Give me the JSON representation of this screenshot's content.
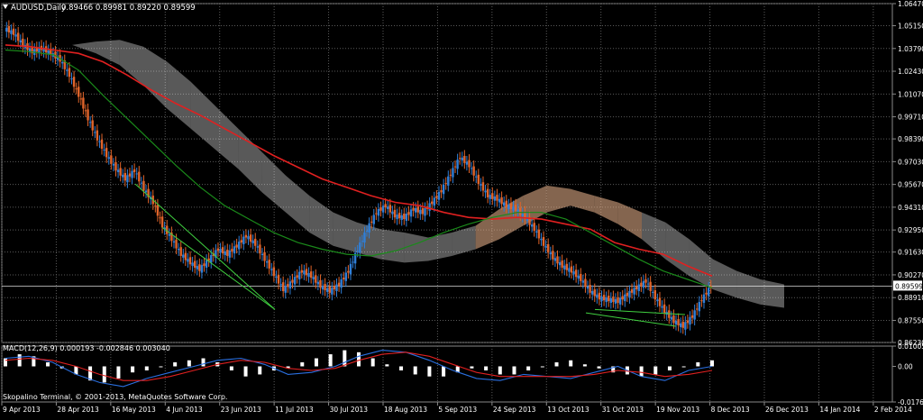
{
  "window": {
    "title": "AUDUSD,Daily",
    "ohlc": "0.89466 0.89981 0.89220 0.89599",
    "copyright": "Skopalino Terminal, © 2001-2013, MetaQuotes Software Corp."
  },
  "colors": {
    "background": "#000000",
    "grid": "#5a5a5a",
    "axis_text": "#ffffff",
    "bull_candle": "#2f7fd8",
    "bear_candle": "#e0642a",
    "ma_slow": "#e02020",
    "ma_fast": "#1a8a1a",
    "cloud_bull": "#f0b890",
    "cloud_bear": "#ffffff",
    "trendline": "#40d040",
    "macd_hist": "#ffffff",
    "macd_line": "#2a6fe0",
    "signal_line": "#e02020",
    "price_label_bg": "#ffffff",
    "price_label_text": "#000000"
  },
  "chart_data": [
    {
      "type": "candlestick",
      "name": "main",
      "yticks": [
        "1.06470",
        "1.05150",
        "1.03790",
        "1.02430",
        "1.01070",
        "0.99710",
        "0.98390",
        "0.97030",
        "0.95670",
        "0.94310",
        "0.92950",
        "0.91630",
        "0.90270",
        "0.88910",
        "0.87550",
        "0.86230"
      ],
      "ylim": [
        0.8623,
        1.0647
      ],
      "current_price": "0.89599",
      "xticks": [
        "9 Apr 2013",
        "28 Apr 2013",
        "16 May 2013",
        "4 Jun 2013",
        "23 Jun 2013",
        "11 Jul 2013",
        "30 Jul 2013",
        "18 Aug 2013",
        "5 Sep 2013",
        "24 Sep 2013",
        "13 Oct 2013",
        "31 Oct 2013",
        "19 Nov 2013",
        "8 Dec 2013",
        "26 Dec 2013",
        "14 Jan 2014",
        "2 Feb 2014"
      ],
      "close_path": [
        1.05,
        1.047,
        1.04,
        1.036,
        1.038,
        1.035,
        1.031,
        1.022,
        1.01,
        0.996,
        0.984,
        0.974,
        0.966,
        0.96,
        0.965,
        0.954,
        0.946,
        0.932,
        0.924,
        0.915,
        0.91,
        0.906,
        0.912,
        0.918,
        0.915,
        0.92,
        0.926,
        0.921,
        0.912,
        0.903,
        0.894,
        0.899,
        0.905,
        0.902,
        0.896,
        0.893,
        0.897,
        0.905,
        0.918,
        0.93,
        0.94,
        0.944,
        0.938,
        0.937,
        0.942,
        0.94,
        0.946,
        0.953,
        0.963,
        0.973,
        0.968,
        0.958,
        0.95,
        0.948,
        0.944,
        0.942,
        0.937,
        0.93,
        0.921,
        0.913,
        0.908,
        0.905,
        0.9,
        0.893,
        0.889,
        0.888,
        0.887,
        0.891,
        0.895,
        0.899,
        0.889,
        0.881,
        0.875,
        0.872,
        0.878,
        0.888,
        0.896
      ],
      "ma_slow": [
        1.04,
        1.039,
        1.037,
        1.035,
        1.03,
        1.022,
        1.013,
        1.005,
        0.998,
        0.99,
        0.982,
        0.974,
        0.967,
        0.96,
        0.955,
        0.95,
        0.946,
        0.944,
        0.94,
        0.937,
        0.936,
        0.937,
        0.936,
        0.933,
        0.93,
        0.922,
        0.918,
        0.915,
        0.908,
        0.902
      ],
      "ma_fast": [
        1.037,
        1.036,
        1.034,
        1.025,
        1.01,
        0.996,
        0.982,
        0.968,
        0.955,
        0.944,
        0.936,
        0.928,
        0.922,
        0.918,
        0.915,
        0.914,
        0.917,
        0.922,
        0.928,
        0.933,
        0.937,
        0.94,
        0.94,
        0.936,
        0.928,
        0.92,
        0.912,
        0.905,
        0.9,
        0.895
      ],
      "cloud_upper": [
        1.04,
        1.042,
        1.043,
        1.039,
        1.03,
        1.018,
        1.004,
        0.99,
        0.976,
        0.962,
        0.95,
        0.94,
        0.934,
        0.93,
        0.928,
        0.925,
        0.928,
        0.932,
        0.942,
        0.95,
        0.956,
        0.954,
        0.95,
        0.946,
        0.94,
        0.934,
        0.924,
        0.912,
        0.905,
        0.9,
        0.897
      ],
      "cloud_lower": [
        1.04,
        1.035,
        1.028,
        1.016,
        1.002,
        0.99,
        0.978,
        0.966,
        0.952,
        0.94,
        0.928,
        0.92,
        0.916,
        0.912,
        0.91,
        0.911,
        0.914,
        0.918,
        0.924,
        0.932,
        0.94,
        0.944,
        0.94,
        0.933,
        0.924,
        0.912,
        0.902,
        0.894,
        0.889,
        0.885,
        0.883
      ]
    },
    {
      "type": "macd",
      "name": "indicator",
      "label": "MACD(12,26,9) 0.000193 -0.002846 0.003040",
      "yticks": [
        "0.010055",
        "0.00",
        "-0.017659"
      ],
      "ylim": [
        -0.017659,
        0.010055
      ],
      "histogram": [
        0.004,
        0.006,
        0.005,
        0.002,
        -0.001,
        -0.004,
        -0.007,
        -0.008,
        -0.006,
        -0.003,
        -0.002,
        0.0,
        0.002,
        0.003,
        0.004,
        0.002,
        -0.002,
        -0.005,
        -0.004,
        -0.002,
        -0.001,
        0.002,
        0.004,
        0.006,
        0.008,
        0.007,
        0.004,
        0.001,
        -0.002,
        -0.004,
        -0.005,
        -0.005,
        -0.003,
        -0.001,
        -0.002,
        -0.004,
        -0.004,
        -0.002,
        0.0,
        0.002,
        0.003,
        0.001,
        -0.001,
        -0.003,
        -0.004,
        -0.005,
        -0.004,
        -0.002,
        0.0,
        0.002,
        0.003
      ],
      "macd_line": [
        0.004,
        0.005,
        0.002,
        -0.004,
        -0.008,
        -0.01,
        -0.006,
        -0.003,
        0.0,
        0.003,
        0.004,
        0.001,
        -0.004,
        -0.003,
        0.0,
        0.005,
        0.008,
        0.007,
        0.003,
        -0.002,
        -0.006,
        -0.007,
        -0.004,
        -0.005,
        -0.006,
        -0.003,
        0.0,
        -0.005,
        -0.007,
        -0.002,
        0.0
      ],
      "signal_line": [
        0.003,
        0.004,
        0.003,
        0.0,
        -0.004,
        -0.007,
        -0.007,
        -0.005,
        -0.002,
        0.001,
        0.003,
        0.002,
        -0.001,
        -0.002,
        -0.001,
        0.003,
        0.006,
        0.007,
        0.005,
        0.001,
        -0.003,
        -0.005,
        -0.005,
        -0.005,
        -0.005,
        -0.004,
        -0.002,
        -0.003,
        -0.005,
        -0.004,
        -0.002
      ]
    }
  ]
}
